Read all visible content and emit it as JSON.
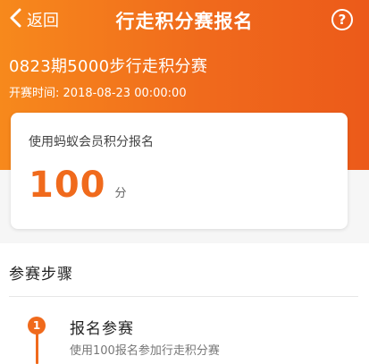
{
  "navbar": {
    "back_label": "返回",
    "title": "行走积分赛报名",
    "help_symbol": "?"
  },
  "event": {
    "name": "0823期5000步行走积分赛",
    "start_label": "开赛时间:",
    "start_time": "2018-08-23 00:00:00"
  },
  "card": {
    "label": "使用蚂蚁会员积分报名",
    "points": "100",
    "unit": "分"
  },
  "steps_section": {
    "title": "参赛步骤",
    "steps": [
      {
        "number": "1",
        "title": "报名参赛",
        "desc": "使用100报名参加行走积分赛"
      }
    ]
  },
  "colors": {
    "accent": "#f06a1c",
    "gradient_start": "#f7891c",
    "gradient_end": "#ec5a1a"
  },
  "icons": {
    "back": "chevron-left-icon",
    "help": "question-circle-icon"
  }
}
